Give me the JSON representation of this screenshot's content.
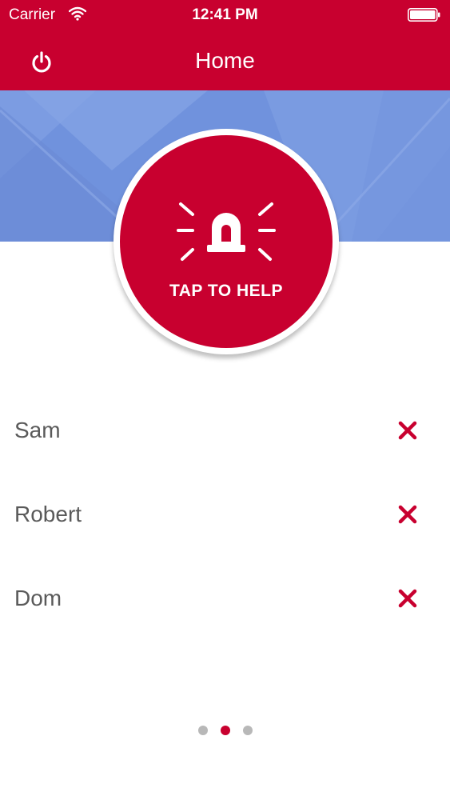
{
  "status_bar": {
    "carrier": "Carrier",
    "time": "12:41 PM",
    "icons": [
      "wifi-icon",
      "battery-icon"
    ]
  },
  "nav": {
    "title": "Home",
    "left_icon": "power-icon"
  },
  "help_button": {
    "label": "TAP TO HELP",
    "icon": "siren-icon"
  },
  "contacts": [
    {
      "name": "Sam",
      "action_icon": "close-icon"
    },
    {
      "name": "Robert",
      "action_icon": "close-icon"
    },
    {
      "name": "Dom",
      "action_icon": "close-icon"
    }
  ],
  "pager": {
    "pages": 3,
    "current": 2
  },
  "colors": {
    "brand_red": "#c8002f",
    "banner_blue": "#7092dd",
    "dot_inactive": "#b8b8b8",
    "text_gray": "#5a5a5a"
  }
}
